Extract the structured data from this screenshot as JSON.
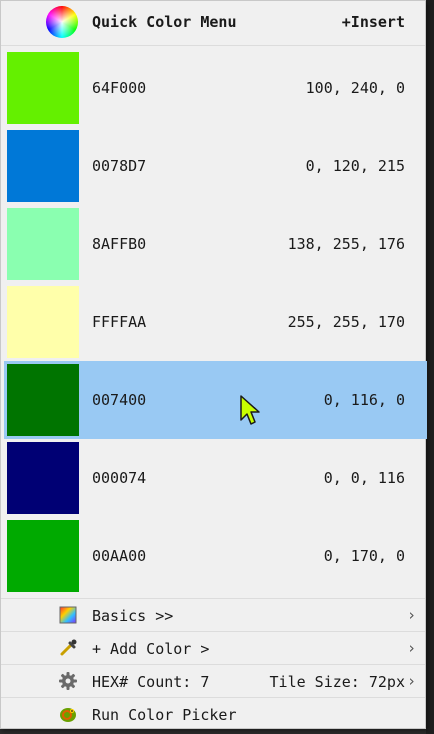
{
  "menu": {
    "title": "Quick Color Menu",
    "insert_label": "+Insert"
  },
  "colors": [
    {
      "hex": "64F000",
      "rgb": "100, 240, 0",
      "swatch": "#64F000"
    },
    {
      "hex": "0078D7",
      "rgb": "0, 120, 215",
      "swatch": "#0078D7"
    },
    {
      "hex": "8AFFB0",
      "rgb": "138, 255, 176",
      "swatch": "#8AFFB0"
    },
    {
      "hex": "FFFFAA",
      "rgb": "255, 255, 170",
      "swatch": "#FFFFAA"
    },
    {
      "hex": "007400",
      "rgb": "0, 116, 0",
      "swatch": "#007400",
      "selected": true
    },
    {
      "hex": "000074",
      "rgb": "0, 0, 116",
      "swatch": "#000074"
    },
    {
      "hex": "00AA00",
      "rgb": "0, 170, 0",
      "swatch": "#00AA00"
    }
  ],
  "footer": {
    "basics": "Basics >>",
    "add_color": "+ Add Color >",
    "hex_count": "HEX# Count: 7",
    "tile_size": "Tile Size: 72px",
    "run_picker": "Run Color Picker"
  },
  "icons": {
    "header": "color-wheel-icon",
    "basics": "palette-icon",
    "add_color": "eyedropper-icon",
    "settings": "gear-icon",
    "picker": "chameleon-icon",
    "chevron": "chevron-right-icon"
  },
  "colors_theme": {
    "selected_row": "#99c9f3",
    "cursor": "#c8ff00"
  }
}
